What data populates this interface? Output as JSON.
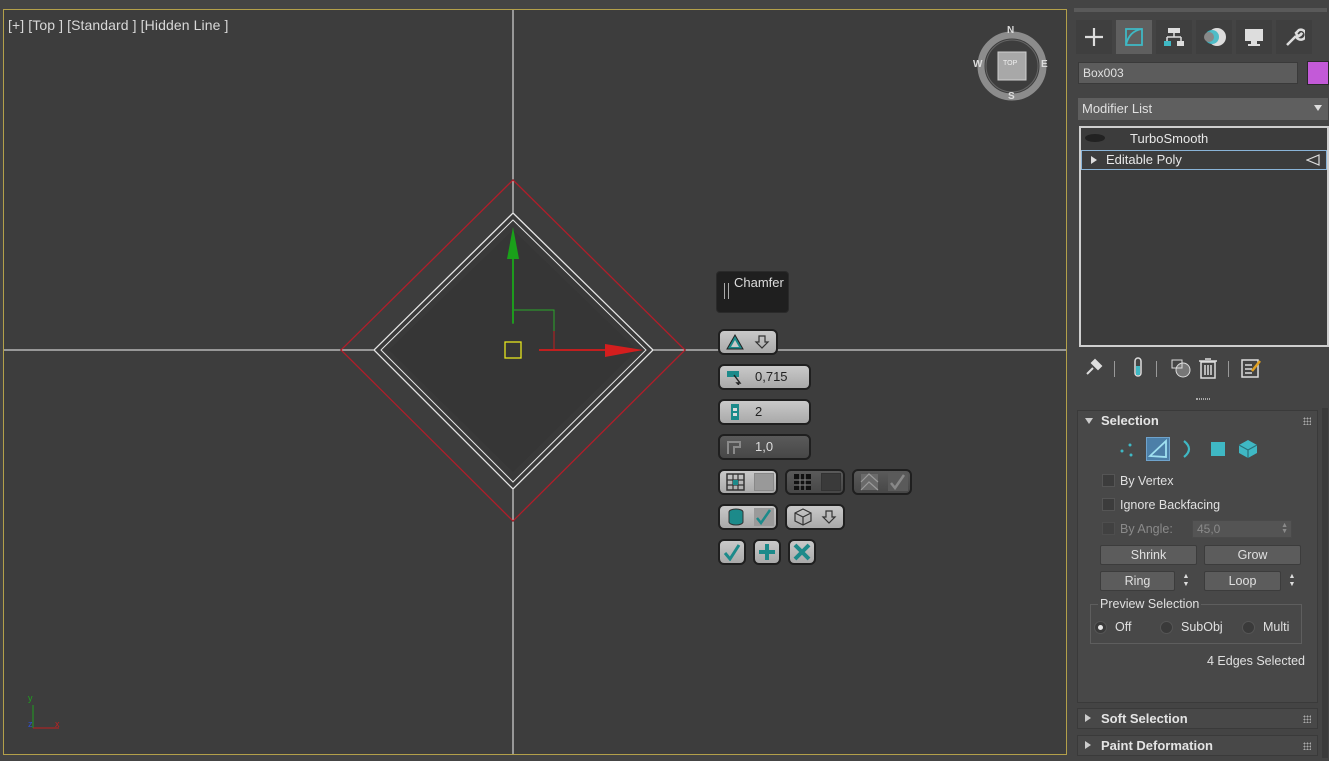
{
  "viewport": {
    "label": "[+] [Top ] [Standard ] [Hidden Line ]",
    "viewcube": {
      "face": "TOP",
      "n": "N",
      "s": "S",
      "e": "E",
      "w": "W"
    },
    "axis": {
      "y": "y",
      "z": "z",
      "x": "x"
    }
  },
  "caddy": {
    "title": "Chamfer",
    "amount": "0,715",
    "segments": "2",
    "tension": "1,0"
  },
  "panel": {
    "tabs": [
      "create-tab",
      "modify-tab",
      "hierarchy-tab",
      "motion-tab",
      "display-tab",
      "utilities-tab"
    ],
    "object_name": "Box003",
    "object_color": "#c35ad8",
    "modifier_list": "Modifier List",
    "stack": [
      {
        "label": "TurboSmooth"
      },
      {
        "label": "Editable Poly"
      }
    ],
    "selection": {
      "title": "Selection",
      "by_vertex": "By Vertex",
      "ignore_backfacing": "Ignore Backfacing",
      "by_angle": "By Angle:",
      "angle_value": "45,0",
      "shrink": "Shrink",
      "grow": "Grow",
      "ring": "Ring",
      "loop": "Loop",
      "preview_selection": "Preview Selection",
      "off": "Off",
      "subobj": "SubObj",
      "multi": "Multi",
      "status": "4 Edges Selected"
    },
    "soft_selection": "Soft Selection",
    "paint_deformation": "Paint Deformation"
  },
  "colors": {
    "viewport_border": "#b3a04a",
    "accent_teal": "#3fb8c4",
    "selected_edge": "#b01e2a"
  }
}
